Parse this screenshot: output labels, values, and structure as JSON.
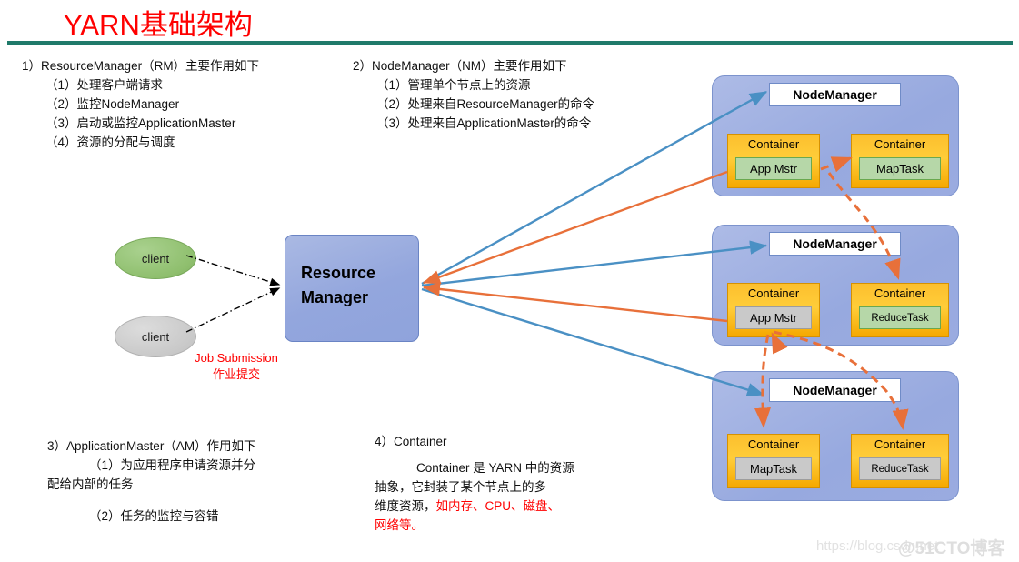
{
  "title": "YARN基础架构",
  "sections": {
    "rm": {
      "heading": "1）ResourceManager（RM）主要作用如下",
      "items": [
        "（1）处理客户端请求",
        "（2）监控NodeManager",
        "（3）启动或监控ApplicationMaster",
        "（4）资源的分配与调度"
      ]
    },
    "nm": {
      "heading": "2）NodeManager（NM）主要作用如下",
      "items": [
        "（1）管理单个节点上的资源",
        "（2）处理来自ResourceManager的命令",
        "（3）处理来自ApplicationMaster的命令"
      ]
    },
    "am": {
      "heading": "3）ApplicationMaster（AM）作用如下",
      "items": [
        "（1）为应用程序申请资源并分",
        "配给内部的任务",
        "（2）任务的监控与容错"
      ]
    },
    "container": {
      "heading": "4）Container",
      "line1": "Container 是 YARN 中的资源",
      "line2": "抽象，它封装了某个节点上的多",
      "line3_plain": "维度资源，",
      "line3_red": "如内存、CPU、磁盘、",
      "line4_red": "网络等。"
    }
  },
  "diagram": {
    "clients": [
      {
        "label": "client",
        "color": "#8fbf6e"
      },
      {
        "label": "client",
        "color": "#c9c9c9"
      }
    ],
    "resource_manager": {
      "line1": "Resource",
      "line2": "Manager",
      "color": "#93a6dd"
    },
    "job_submission": {
      "line_en": "Job Submission",
      "line_zh": "作业提交",
      "color": "#ff0000"
    },
    "node_managers": [
      {
        "title": "NodeManager",
        "containers": [
          {
            "label": "Container",
            "task": "App Mstr",
            "task_style": "green"
          },
          {
            "label": "Container",
            "task": "MapTask",
            "task_style": "green"
          }
        ]
      },
      {
        "title": "NodeManager",
        "containers": [
          {
            "label": "Container",
            "task": "App Mstr",
            "task_style": "gray"
          },
          {
            "label": "Container",
            "task": "ReduceTask",
            "task_style": "green"
          }
        ]
      },
      {
        "title": "NodeManager",
        "containers": [
          {
            "label": "Container",
            "task": "MapTask",
            "task_style": "gray"
          },
          {
            "label": "Container",
            "task": "ReduceTask",
            "task_style": "gray"
          }
        ]
      }
    ],
    "arrow_colors": {
      "control": "#4a90c4",
      "request": "#e8703a",
      "submit": "#000000"
    }
  },
  "watermarks": {
    "csdn": "https://blog.csdn.net",
    "cto": "@51CTO博客"
  }
}
